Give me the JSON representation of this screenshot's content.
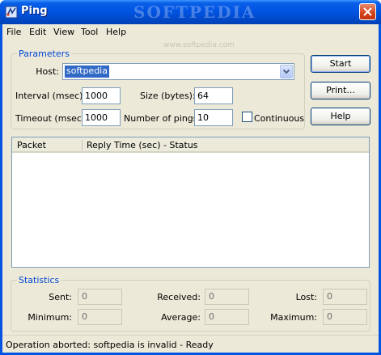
{
  "window": {
    "title": "Ping",
    "watermark": "SOFTPEDIA",
    "sub_watermark": "www.softpedia.com"
  },
  "menu": [
    "File",
    "Edit",
    "View",
    "Tool",
    "Help"
  ],
  "parameters": {
    "legend": "Parameters",
    "host_label": "Host:",
    "host_value": "softpedia",
    "interval_label": "Interval (msec):",
    "interval_value": "1000",
    "size_label": "Size (bytes):",
    "size_value": "64",
    "timeout_label": "Timeout (msec):",
    "timeout_value": "1000",
    "pings_label": "Number of pings:",
    "pings_value": "10",
    "continuous_label": "Continuous",
    "continuous_checked": false
  },
  "buttons": {
    "start": "Start",
    "print": "Print...",
    "help": "Help"
  },
  "results": {
    "columns": [
      "Packet",
      "Reply Time (sec) - Status"
    ],
    "rows": []
  },
  "statistics": {
    "legend": "Statistics",
    "sent_label": "Sent:",
    "sent_value": "0",
    "received_label": "Received:",
    "received_value": "0",
    "lost_label": "Lost:",
    "lost_value": "0",
    "minimum_label": "Minimum:",
    "minimum_value": "0",
    "average_label": "Average:",
    "average_value": "0",
    "maximum_label": "Maximum:",
    "maximum_value": "0"
  },
  "status": "Operation aborted: softpedia is invalid - Ready",
  "colors": {
    "titlebar": "#0054e3",
    "legend_text": "#0046d5",
    "selection": "#316ac5"
  }
}
